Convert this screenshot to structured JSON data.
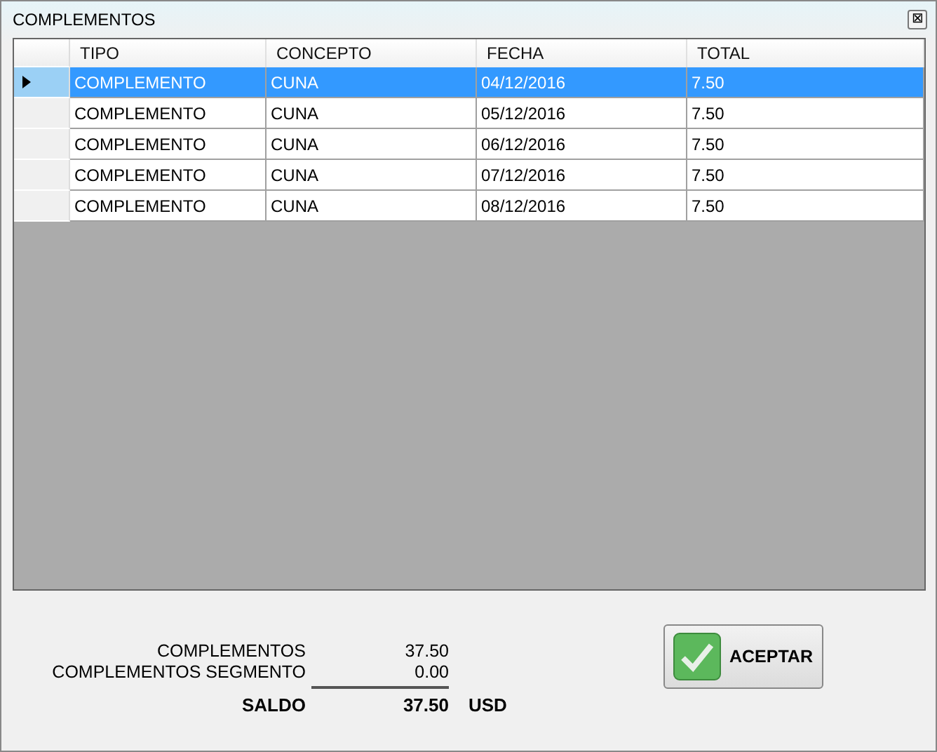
{
  "window": {
    "title": "COMPLEMENTOS",
    "close": "⊠"
  },
  "table": {
    "columns": [
      "TIPO",
      "CONCEPTO",
      "FECHA",
      "TOTAL"
    ],
    "rows": [
      {
        "cells": [
          "COMPLEMENTO",
          "CUNA",
          "04/12/2016",
          "7.50"
        ],
        "selected": true
      },
      {
        "cells": [
          "COMPLEMENTO",
          "CUNA",
          "05/12/2016",
          "7.50"
        ],
        "selected": false
      },
      {
        "cells": [
          "COMPLEMENTO",
          "CUNA",
          "06/12/2016",
          "7.50"
        ],
        "selected": false
      },
      {
        "cells": [
          "COMPLEMENTO",
          "CUNA",
          "07/12/2016",
          "7.50"
        ],
        "selected": false
      },
      {
        "cells": [
          "COMPLEMENTO",
          "CUNA",
          "08/12/2016",
          "7.50"
        ],
        "selected": false
      }
    ]
  },
  "summary": {
    "lines": [
      {
        "label": "COMPLEMENTOS",
        "value": "37.50"
      },
      {
        "label": "COMPLEMENTOS SEGMENTO",
        "value": "0.00"
      }
    ],
    "total": {
      "label": "SALDO",
      "value": "37.50",
      "currency": "USD"
    }
  },
  "button": {
    "label": "ACEPTAR"
  }
}
